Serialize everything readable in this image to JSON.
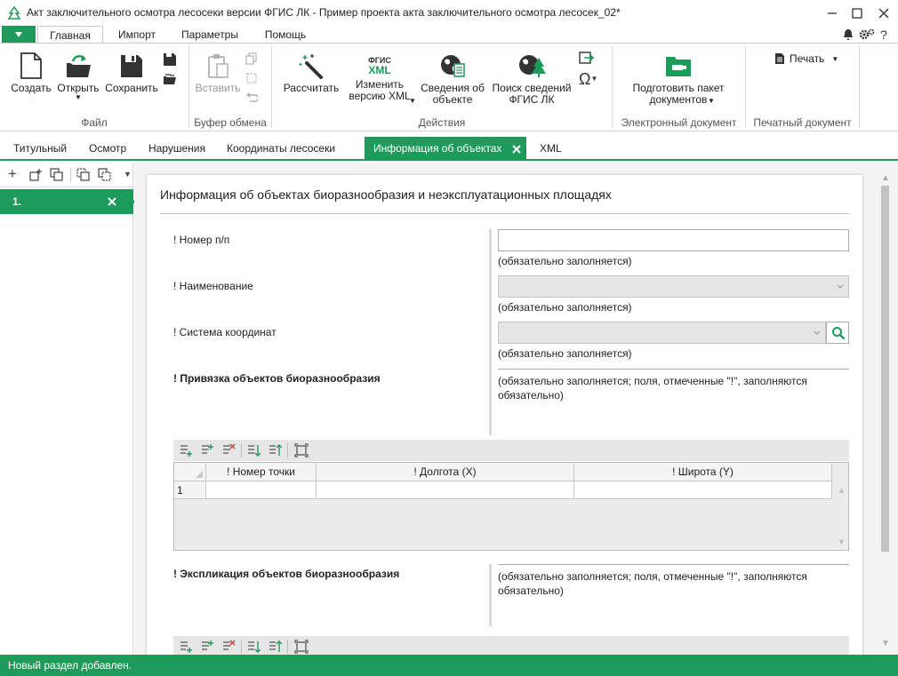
{
  "window": {
    "title": "Акт заключительного осмотра лесосеки версии ФГИС ЛК - Пример проекта акта заключительного осмотра лесосек_02*"
  },
  "menu": {
    "tabs": [
      "Главная",
      "Импорт",
      "Параметры",
      "Помощь"
    ],
    "help_label": "?"
  },
  "ribbon": {
    "create": "Создать",
    "open": "Открыть",
    "save": "Сохранить",
    "paste": "Вставить",
    "calc": "Рассчитать",
    "change_xml": "Изменить\nверсию XML",
    "xml_icon_top": "ФГИС",
    "xml_icon_bottom": "XML",
    "object_info": "Сведения об\nобъекте",
    "search_fgis": "Поиск сведений\nФГИС ЛК",
    "prepare_package": "Подготовить пакет\nдокументов",
    "print": "Печать",
    "groups": {
      "file": "Файл",
      "clipboard": "Буфер обмена",
      "actions": "Действия",
      "edoc": "Электронный документ",
      "printdoc": "Печатный документ"
    }
  },
  "doc_tabs": [
    "Титульный",
    "Осмотр",
    "Нарушения",
    "Координаты лесосеки",
    "Информация об объектах",
    "XML"
  ],
  "left_pane": {
    "item_label": "1."
  },
  "form": {
    "heading": "Информация об объектах биоразнообразия и неэксплуатационных площадях",
    "required_note": "(обязательно заполняется)",
    "required_note_long": "(обязательно заполняется; поля, отмеченные \"!\", заполняются обязательно)",
    "fields": {
      "number": "! Номер п/п",
      "name": "! Наименование",
      "coord_system": "! Система координат",
      "binding": "! Привязка объектов биоразнообразия",
      "explication": "! Экспликация объектов биоразнообразия"
    },
    "grid": {
      "columns": [
        "! Номер точки",
        "! Долгота (X)",
        "! Широта (Y)"
      ],
      "row_number": "1"
    }
  },
  "status": {
    "text": "Новый раздел добавлен."
  },
  "colors": {
    "accent": "#1e9b5a"
  }
}
